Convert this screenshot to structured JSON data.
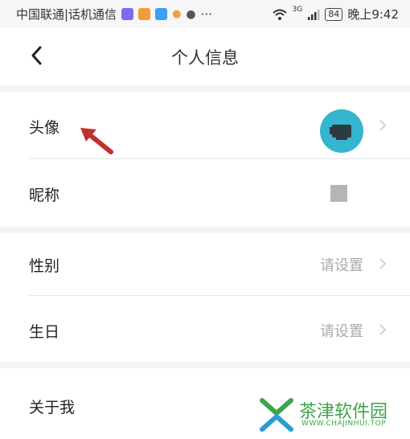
{
  "status_bar": {
    "carrier": "中国联通|话机通信",
    "more": "···",
    "network": "3G",
    "battery": "84",
    "time": "晚上9:42"
  },
  "header": {
    "title": "个人信息",
    "back_icon": "chevron-left-icon"
  },
  "rows": [
    {
      "label": "头像",
      "value": ""
    },
    {
      "label": "昵称",
      "value": ""
    },
    {
      "label": "性别",
      "value": "请设置"
    },
    {
      "label": "生日",
      "value": "请设置"
    },
    {
      "label": "关于我",
      "value": ""
    }
  ],
  "watermark": {
    "text": "茶津软件园",
    "url": "WWW.CHAJINHUI.TOP"
  },
  "colors": {
    "avatar_bg": "#35b6ce",
    "arrow": "#c0332a",
    "watermark": "#3fa34d"
  }
}
